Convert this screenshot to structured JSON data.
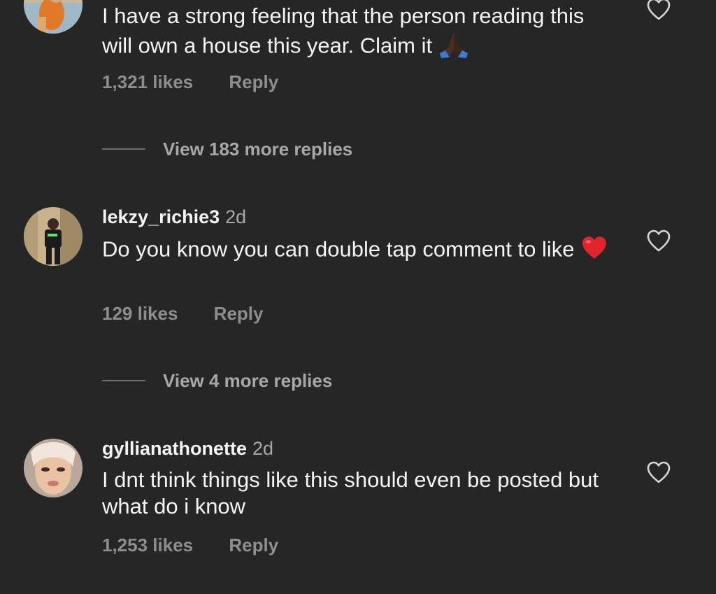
{
  "comments": [
    {
      "username": "",
      "timestamp": "",
      "text": "I have a strong feeling that the person reading this will own a house this year. Claim it",
      "emoji": "praying-hands-dark",
      "likes": "1,321 likes",
      "reply_label": "Reply",
      "view_replies": "View 183 more replies",
      "like_icon": "heart-outline-icon"
    },
    {
      "username": "lekzy_richie3",
      "timestamp": "2d",
      "text": "Do you know you can double tap comment to like",
      "emoji": "red-heart",
      "likes": "129 likes",
      "reply_label": "Reply",
      "view_replies": "View 4 more replies",
      "like_icon": "heart-outline-icon"
    },
    {
      "username": "gyllianathonette",
      "timestamp": "2d",
      "text": "I dnt think things like this should even be posted but what do i know",
      "emoji": "",
      "likes": "1,253 likes",
      "reply_label": "Reply",
      "view_replies": "",
      "like_icon": "heart-outline-icon"
    }
  ],
  "colors": {
    "background": "#262626",
    "primary_text": "#f5f5f5",
    "secondary_text": "#8e8e8e",
    "divider": "#6e6e6e"
  }
}
